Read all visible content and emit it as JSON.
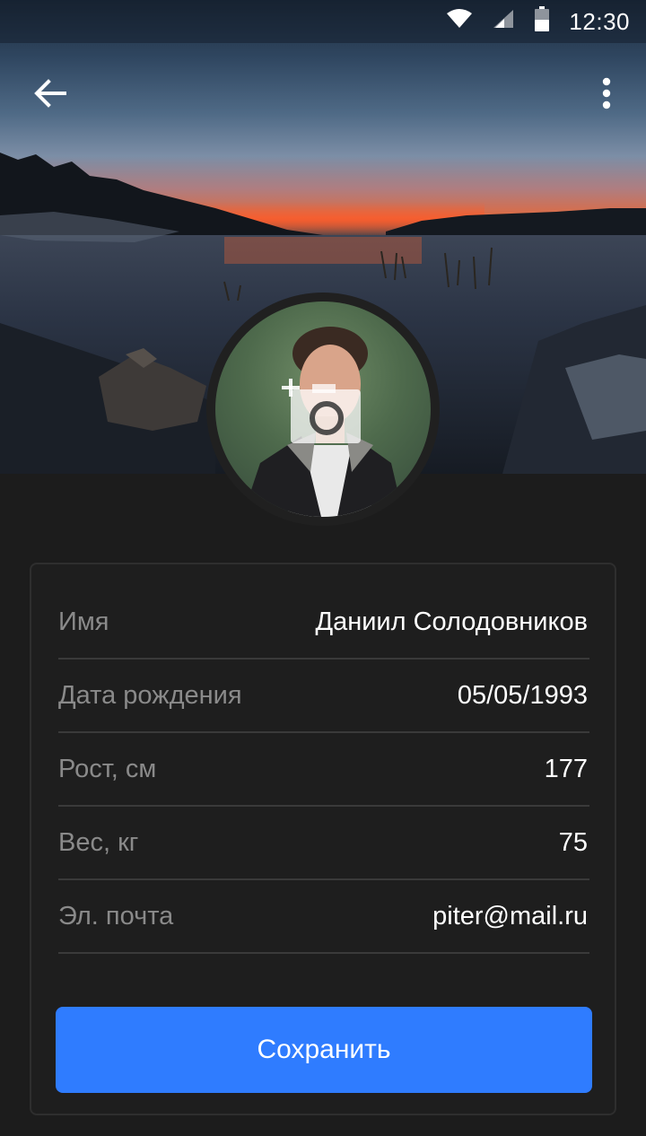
{
  "status_bar": {
    "time": "12:30",
    "icons": [
      "wifi-icon",
      "cellular-signal-icon",
      "battery-icon"
    ]
  },
  "app_bar": {
    "back_icon": "arrow-back-icon",
    "menu_icon": "more-vertical-icon"
  },
  "profile": {
    "avatar_icon": "add-photo-camera-icon"
  },
  "form": {
    "fields": [
      {
        "label": "Имя",
        "value": "Даниил Солодовников"
      },
      {
        "label": "Дата рождения",
        "value": "05/05/1993"
      },
      {
        "label": "Рост, см",
        "value": "177"
      },
      {
        "label": "Вес, кг",
        "value": "75"
      },
      {
        "label": "Эл. почта",
        "value": "piter@mail.ru"
      }
    ],
    "save_label": "Сохранить"
  },
  "colors": {
    "background": "#1c1c1c",
    "accent": "#2f7cff",
    "label": "#8a8a8a",
    "value": "#ffffff",
    "divider": "#3a3a3a"
  }
}
